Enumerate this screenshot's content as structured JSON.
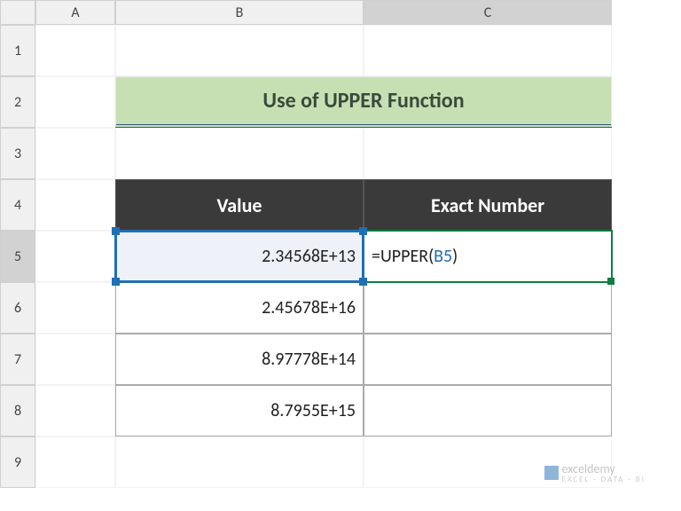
{
  "columns": [
    "A",
    "B",
    "C"
  ],
  "rows": [
    "1",
    "2",
    "3",
    "4",
    "5",
    "6",
    "7",
    "8",
    "9"
  ],
  "title": "Use of UPPER Function",
  "headers": {
    "value": "Value",
    "exact": "Exact Number"
  },
  "data": {
    "b5": "2.34568E+13",
    "b6": "2.45678E+16",
    "b7": "8.97778E+14",
    "b8": "8.7955E+15"
  },
  "formula": {
    "prefix": "=UPPER(",
    "ref": "B5",
    "suffix": ")"
  },
  "chart_data": {
    "type": "table",
    "title": "Use of UPPER Function",
    "columns": [
      "Value",
      "Exact Number"
    ],
    "rows": [
      {
        "Value": "2.34568E+13",
        "Exact Number": "=UPPER(B5)"
      },
      {
        "Value": "2.45678E+16",
        "Exact Number": ""
      },
      {
        "Value": "8.97778E+14",
        "Exact Number": ""
      },
      {
        "Value": "8.7955E+15",
        "Exact Number": ""
      }
    ],
    "active_cell": "C5",
    "referenced_cell": "B5"
  },
  "watermark": {
    "brand": "exceldemy",
    "tag": "EXCEL · DATA · BI"
  }
}
